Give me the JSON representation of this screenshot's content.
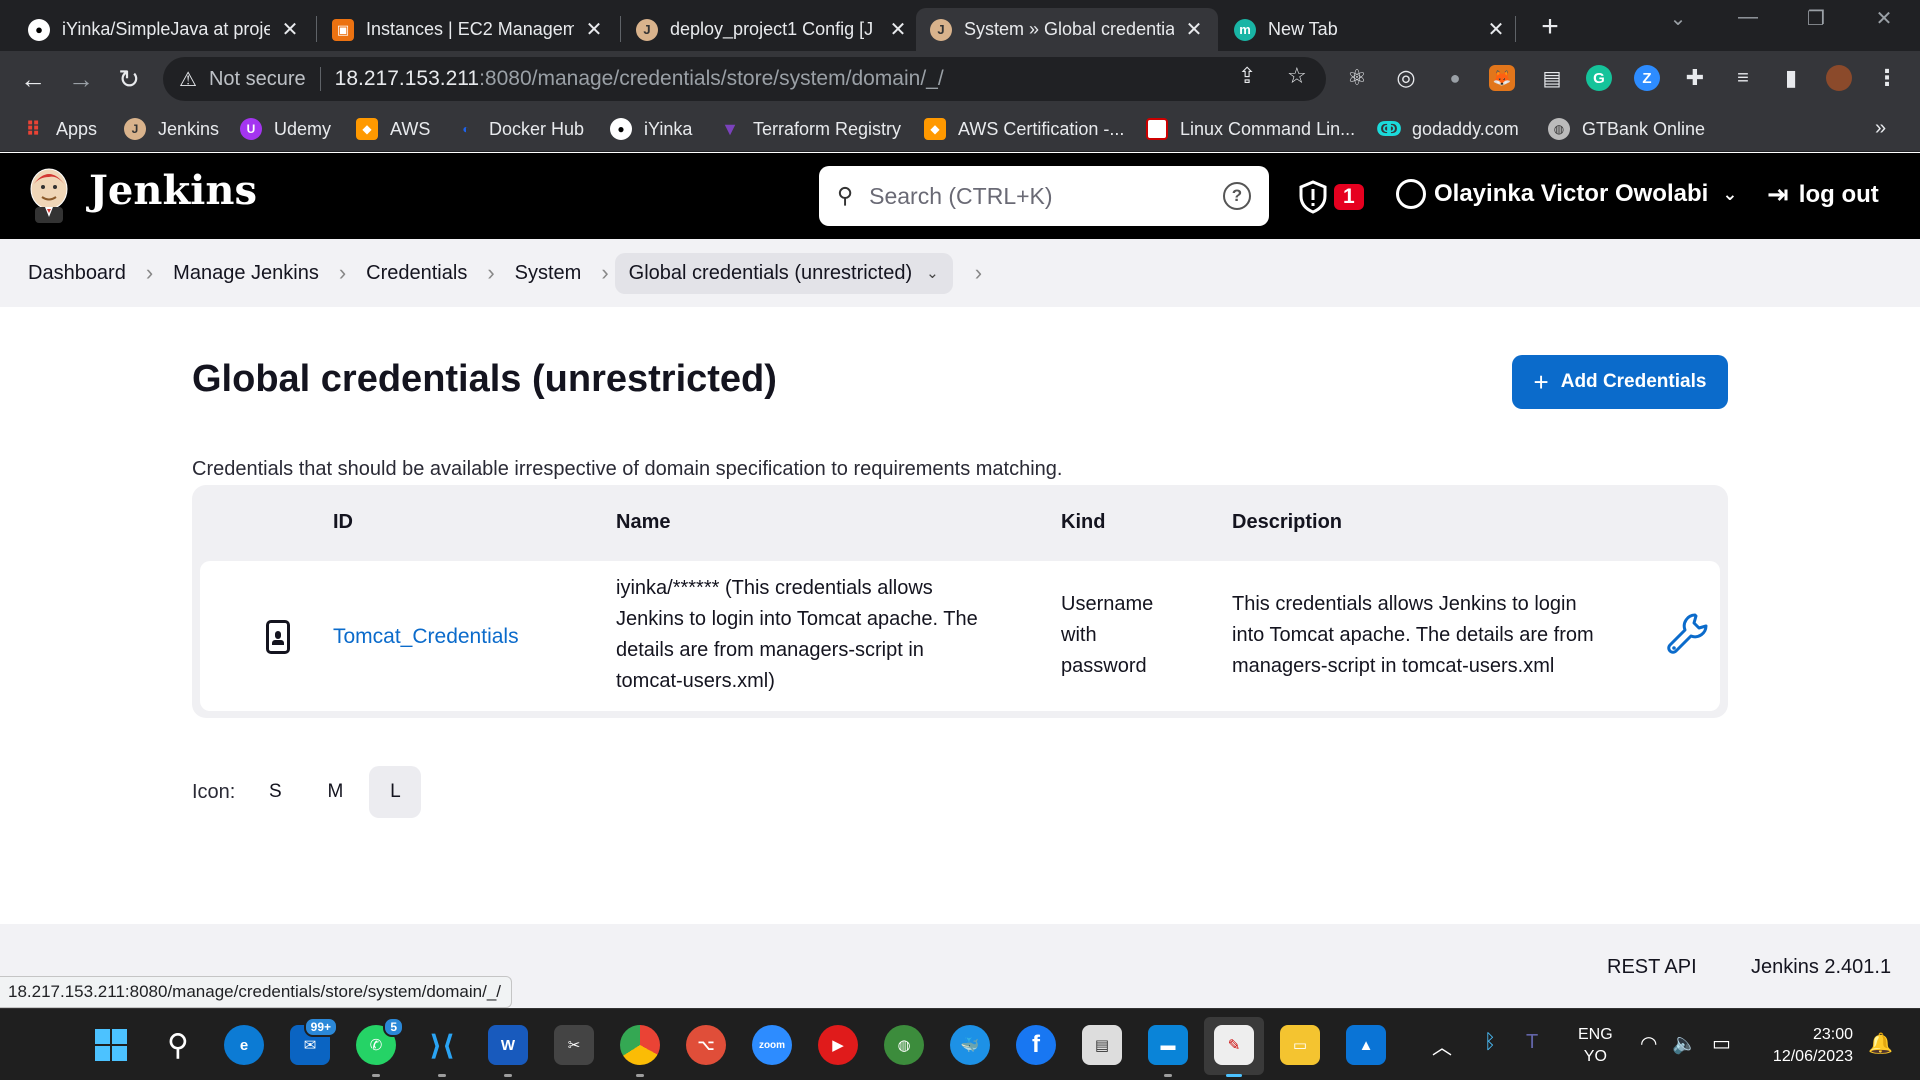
{
  "browser": {
    "tabs": [
      {
        "title": "iYinka/SimpleJava at proje",
        "icon": "github-icon"
      },
      {
        "title": "Instances | EC2 Managem",
        "icon": "aws-ec2-icon"
      },
      {
        "title": "deploy_project1 Config [J",
        "icon": "jenkins-icon"
      },
      {
        "title": "System » Global credentia",
        "icon": "jenkins-icon",
        "active": true
      },
      {
        "title": "New Tab",
        "icon": "m-icon"
      }
    ],
    "security_label": "Not secure",
    "url_host": "18.217.153.211",
    "url_path": ":8080/manage/credentials/store/system/domain/_/",
    "bookmarks": [
      {
        "label": "Apps",
        "icon": "apps-grid-icon"
      },
      {
        "label": "Jenkins",
        "icon": "jenkins-icon"
      },
      {
        "label": "Udemy",
        "icon": "udemy-icon"
      },
      {
        "label": "AWS",
        "icon": "aws-icon"
      },
      {
        "label": "Docker Hub",
        "icon": "docker-icon"
      },
      {
        "label": "iYinka",
        "icon": "github-icon"
      },
      {
        "label": "Terraform Registry",
        "icon": "terraform-icon"
      },
      {
        "label": "AWS Certification -...",
        "icon": "aws-icon"
      },
      {
        "label": "Linux Command Lin...",
        "icon": "page-icon"
      },
      {
        "label": "godaddy.com",
        "icon": "godaddy-icon"
      },
      {
        "label": "GTBank Online",
        "icon": "globe-icon"
      }
    ]
  },
  "jenkins": {
    "brand": "Jenkins",
    "search_placeholder": "Search (CTRL+K)",
    "security_count": "1",
    "user_name": "Olayinka Victor Owolabi",
    "logout_label": "log out"
  },
  "breadcrumbs": [
    "Dashboard",
    "Manage Jenkins",
    "Credentials",
    "System",
    "Global credentials (unrestricted)"
  ],
  "page": {
    "title": "Global credentials (unrestricted)",
    "add_button": "Add Credentials",
    "description": "Credentials that should be available irrespective of domain specification to requirements matching."
  },
  "table": {
    "headers": {
      "id": "ID",
      "name": "Name",
      "kind": "Kind",
      "description": "Description"
    },
    "rows": [
      {
        "id": "Tomcat_Credentials",
        "name_lines": [
          "iyinka/****** (This credentials allows",
          "Jenkins to login into Tomcat apache. The",
          "details are from managers-script in",
          "tomcat-users.xml)"
        ],
        "kind_lines": [
          "Username",
          "with",
          "password"
        ],
        "desc_lines": [
          "This credentials allows Jenkins to login",
          "into Tomcat apache. The details are from",
          "managers-script in tomcat-users.xml"
        ]
      }
    ]
  },
  "icon_size": {
    "label": "Icon:",
    "options": [
      "S",
      "M",
      "L"
    ],
    "selected": "L"
  },
  "footer": {
    "rest_api": "REST API",
    "version": "Jenkins 2.401.1"
  },
  "status_url": "18.217.153.211:8080/manage/credentials/store/system/domain/_/",
  "taskbar": {
    "mail_badge": "99+",
    "whatsapp_badge": "5",
    "lang_line1": "ENG",
    "lang_line2": "YO",
    "time": "23:00",
    "date": "12/06/2023"
  },
  "colors": {
    "accent": "#0b6bcb",
    "header_bg": "#000000",
    "badge_red": "#e6001f"
  }
}
